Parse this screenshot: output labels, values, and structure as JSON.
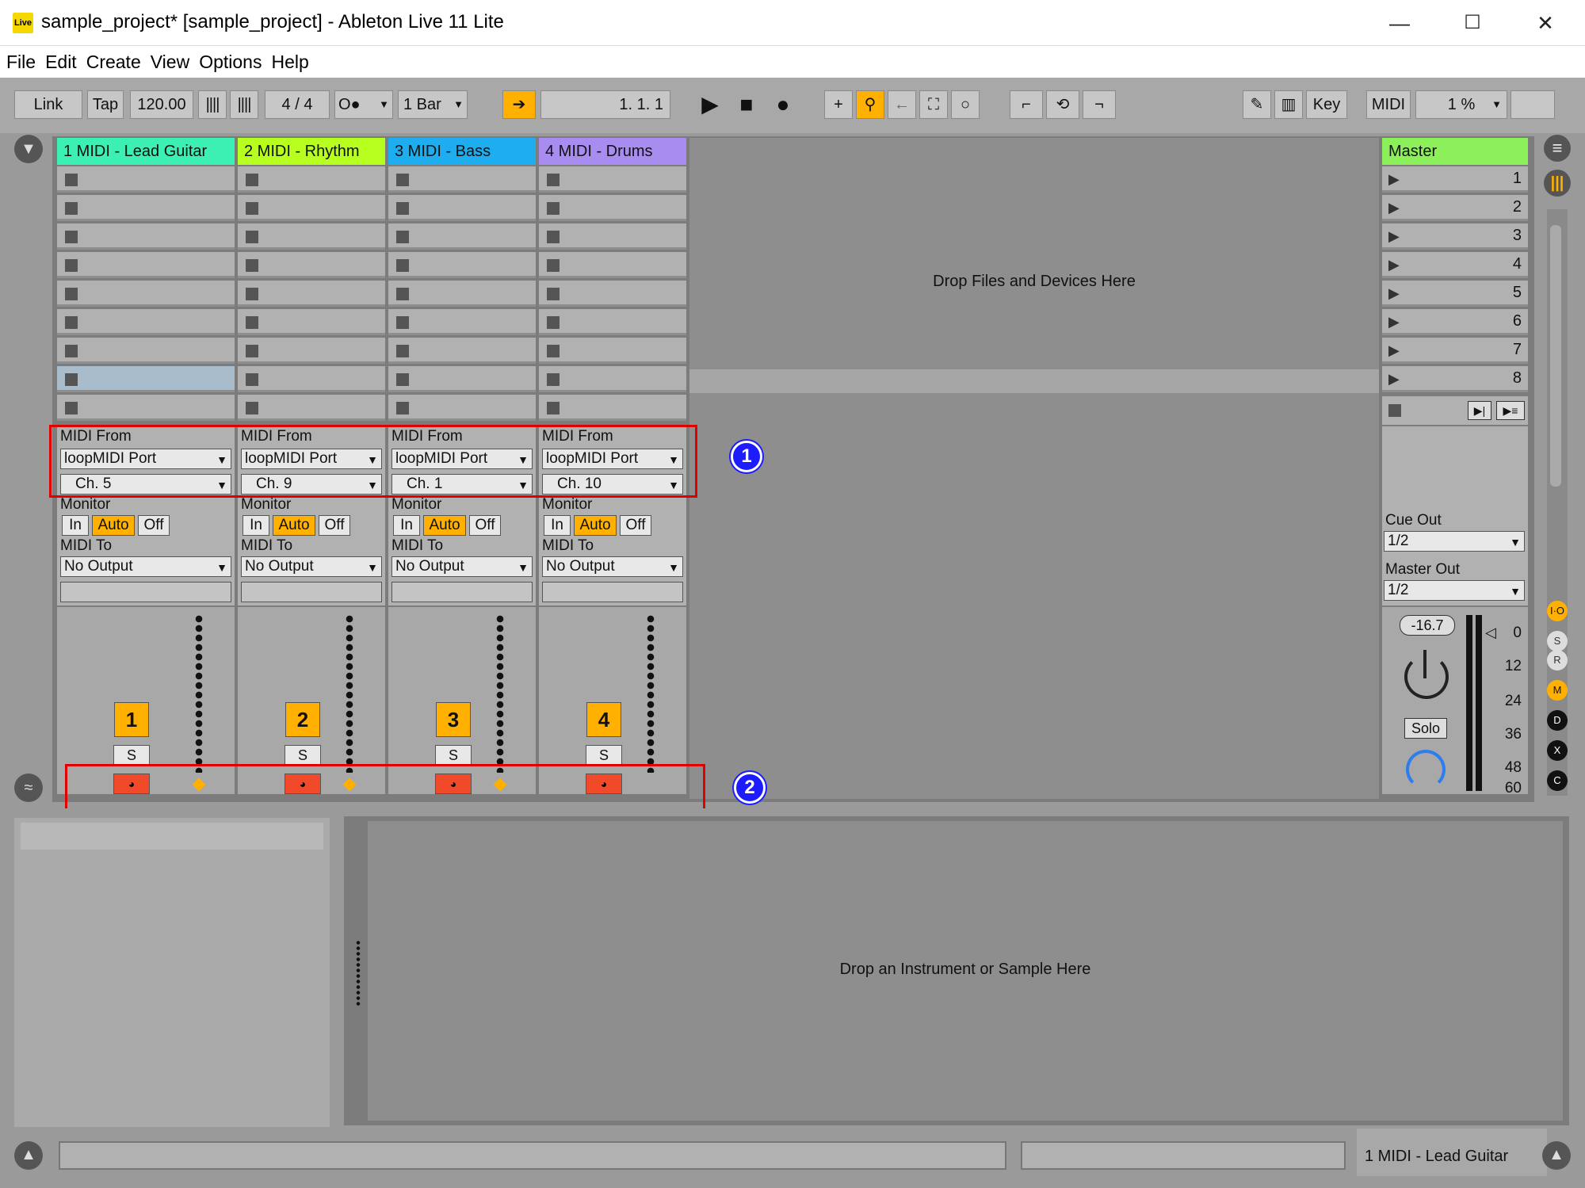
{
  "window": {
    "app_icon": "Live",
    "title": "sample_project*  [sample_project] - Ableton Live 11 Lite",
    "minimize": "—",
    "maximize": "☐",
    "close": "✕"
  },
  "menu": [
    "File",
    "Edit",
    "Create",
    "View",
    "Options",
    "Help"
  ],
  "transport": {
    "link": "Link",
    "tap": "Tap",
    "tempo": "120.00",
    "sig_num": "4",
    "sig_slash": "/",
    "sig_den": "4",
    "metronome": "O●",
    "quantize": "1 Bar",
    "position": "1.   1.   1",
    "key": "Key",
    "midi": "MIDI",
    "cpu": "1 %"
  },
  "tracks": [
    {
      "name": "1 MIDI - Lead Guitar",
      "color": "#3cf0b4",
      "midi_from": "MIDI From",
      "port": "loopMIDI Port",
      "channel": "Ch. 5",
      "monitor": "Monitor",
      "mon_in": "In",
      "mon_auto": "Auto",
      "mon_off": "Off",
      "midi_to": "MIDI To",
      "output": "No Output",
      "number": "1",
      "solo": "S"
    },
    {
      "name": "2 MIDI - Rhythm",
      "color": "#b6ff1e",
      "midi_from": "MIDI From",
      "port": "loopMIDI Port",
      "channel": "Ch. 9",
      "monitor": "Monitor",
      "mon_in": "In",
      "mon_auto": "Auto",
      "mon_off": "Off",
      "midi_to": "MIDI To",
      "output": "No Output",
      "number": "2",
      "solo": "S"
    },
    {
      "name": "3 MIDI - Bass",
      "color": "#1eaef0",
      "midi_from": "MIDI From",
      "port": "loopMIDI Port",
      "channel": "Ch. 1",
      "monitor": "Monitor",
      "mon_in": "In",
      "mon_auto": "Auto",
      "mon_off": "Off",
      "midi_to": "MIDI To",
      "output": "No Output",
      "number": "3",
      "solo": "S"
    },
    {
      "name": "4 MIDI - Drums",
      "color": "#a98cf0",
      "midi_from": "MIDI From",
      "port": "loopMIDI Port",
      "channel": "Ch. 10",
      "monitor": "Monitor",
      "mon_in": "In",
      "mon_auto": "Auto",
      "mon_off": "Off",
      "midi_to": "MIDI To",
      "output": "No Output",
      "number": "4",
      "solo": "S"
    }
  ],
  "session_drop": "Drop Files and Devices Here",
  "master": {
    "name": "Master",
    "color": "#8cf05a",
    "scenes": [
      "1",
      "2",
      "3",
      "4",
      "5",
      "6",
      "7",
      "8"
    ],
    "cue_out": "Cue Out",
    "cue_val": "1/2",
    "master_out": "Master Out",
    "master_val": "1/2",
    "volume": "-16.7",
    "solo": "Solo",
    "db_scale": [
      "0",
      "12",
      "24",
      "36",
      "48",
      "60"
    ]
  },
  "side_icons": [
    "I·O",
    "S",
    "R",
    "M",
    "D",
    "X",
    "C"
  ],
  "annotations": [
    "1",
    "2"
  ],
  "device_drop": "Drop an Instrument or Sample Here",
  "status_track": "1 MIDI - Lead Guitar"
}
